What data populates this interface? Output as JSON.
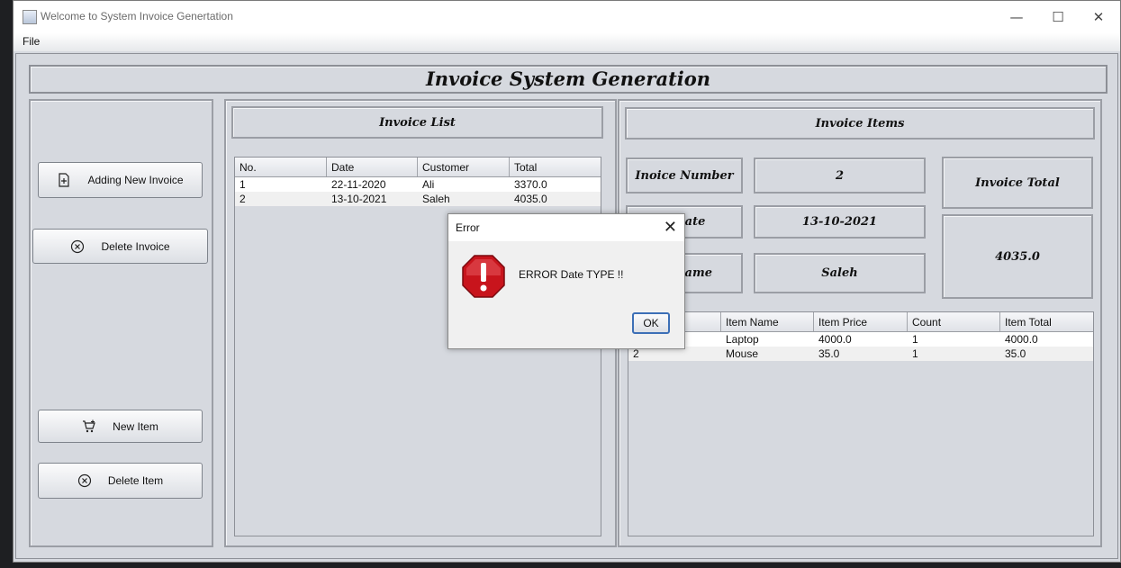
{
  "window": {
    "title": "Welcome to System Invoice Genertation",
    "minimize_glyph": "—",
    "maximize_glyph": "☐",
    "close_glyph": "✕"
  },
  "menu": {
    "file": "File"
  },
  "header": {
    "title": "Invoice System Generation"
  },
  "left_panel": {
    "add_invoice": "Adding New Invoice",
    "delete_invoice": "Delete Invoice",
    "new_item": "New Item",
    "delete_item": "Delete Item"
  },
  "invoice_list": {
    "title": "Invoice List",
    "columns": [
      "No.",
      "Date",
      "Customer",
      "Total"
    ],
    "rows": [
      [
        "1",
        "22-11-2020",
        "Ali",
        "3370.0"
      ],
      [
        "2",
        "13-10-2021",
        "Saleh",
        "4035.0"
      ]
    ]
  },
  "invoice_items": {
    "title": "Invoice Items",
    "number_label": "Inoice Number",
    "number_value": "2",
    "date_label": "e Date",
    "date_value": "13-10-2021",
    "customer_label": "er Name",
    "customer_value": "Saleh",
    "total_label": "Invoice Total",
    "total_value": "4035.0",
    "columns": [
      "Item Name",
      "Item Price",
      "Count",
      "Item Total"
    ],
    "rows": [
      [
        "",
        "Laptop",
        "4000.0",
        "1",
        "4000.0"
      ],
      [
        "2",
        "Mouse",
        "35.0",
        "1",
        "35.0"
      ]
    ]
  },
  "dialog": {
    "title": "Error",
    "message": "ERROR Date TYPE !!",
    "ok": "OK",
    "close_glyph": "✕"
  }
}
